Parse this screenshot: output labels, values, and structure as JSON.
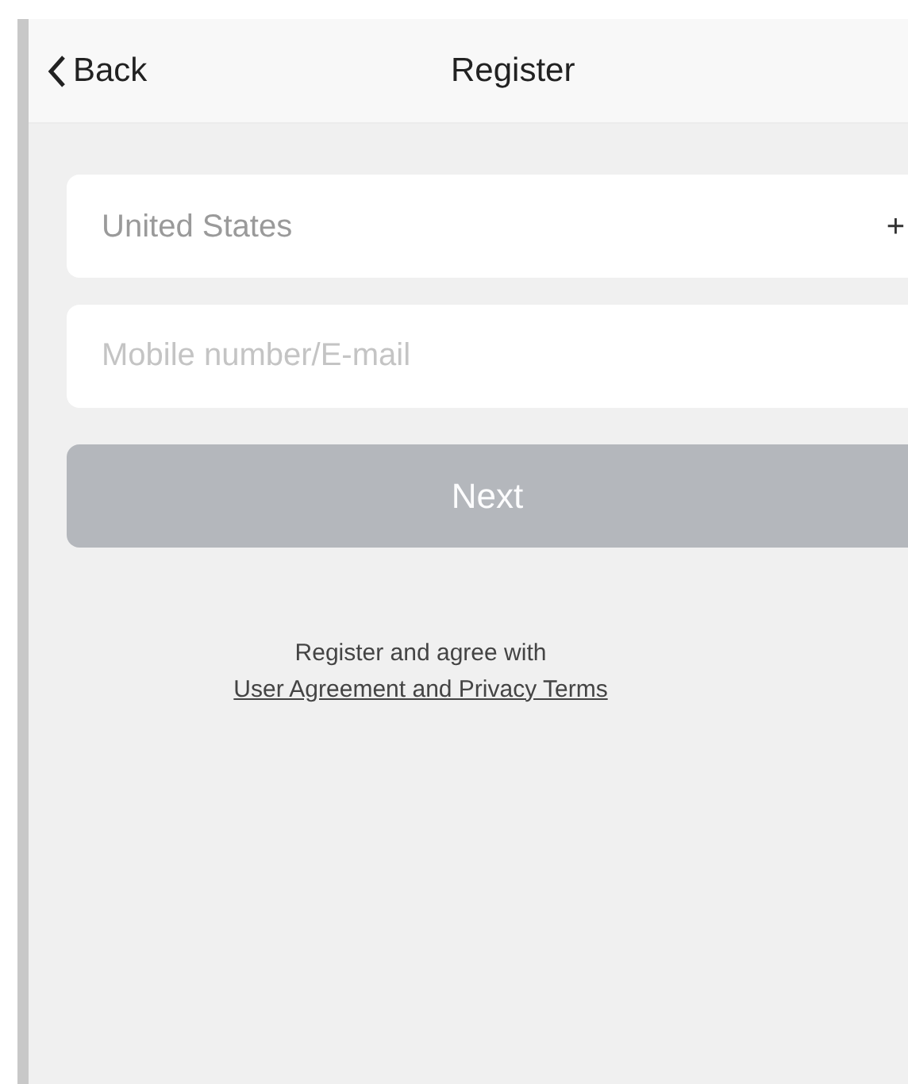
{
  "nav_bar": {
    "back": "Back",
    "title": "Register"
  },
  "country_field": {
    "value": "United States",
    "code": "+"
  },
  "account_field": {
    "placeholder": "Mobile number/E-mail"
  },
  "next_button": {
    "label": "Next",
    "disabled": true
  },
  "agreement": {
    "text": "Register and agree with",
    "link": "User Agreement and Privacy Terms"
  }
}
